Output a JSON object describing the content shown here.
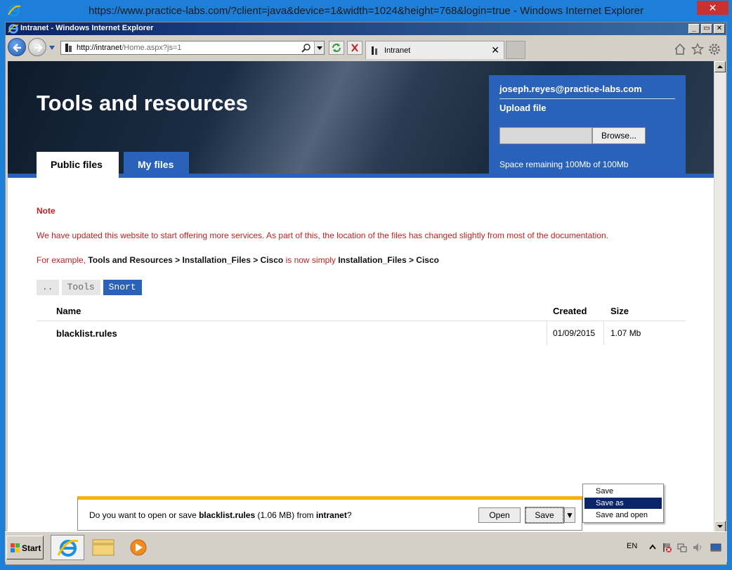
{
  "outer_window": {
    "title": "https://www.practice-labs.com/?client=java&device=1&width=1024&height=768&login=true - Windows  Internet Explorer",
    "close_label": "✕"
  },
  "ie_window": {
    "title": "Intranet - Windows Internet Explorer",
    "minimize_label": "_",
    "restore_label": "▭",
    "close_label": "✕"
  },
  "toolbar": {
    "url_host": "http://intranet",
    "url_path": "/Home.aspx?js=1",
    "tab_label": "Intranet",
    "tab_close_label": "✕"
  },
  "page": {
    "title": "Tools and resources",
    "tabs": [
      {
        "label": "Public files",
        "active": true
      },
      {
        "label": "My files",
        "active": false
      }
    ],
    "user_panel": {
      "email": "joseph.reyes@practice-labs.com",
      "upload_label": "Upload file",
      "browse_label": "Browse...",
      "space": "Space remaining 100Mb of 100Mb"
    },
    "note": {
      "heading": "Note",
      "paragraph": "We have updated this website to start offering more services. As part of this, the location of the files has changed slightly from most of the documentation.",
      "example_prefix": "For example, ",
      "example_old_path": "Tools and Resources > Installation_Files > Cisco",
      "example_mid": " is now simply ",
      "example_new_path": "Installation_Files > Cisco"
    },
    "breadcrumbs": [
      {
        "label": "..",
        "active": false
      },
      {
        "label": "Tools",
        "active": false
      },
      {
        "label": "Snort",
        "active": true
      }
    ],
    "table": {
      "headers": {
        "name": "Name",
        "created": "Created",
        "size": "Size"
      },
      "rows": [
        {
          "name": "blacklist.rules",
          "created": "01/09/2015",
          "size": "1.07 Mb"
        }
      ]
    }
  },
  "download_bar": {
    "msg_prefix": "Do you want to open or save ",
    "file": "blacklist.rules",
    "msg_size": " (1.06 MB) from ",
    "source": "intranet",
    "msg_suffix": "?",
    "open_label": "Open",
    "save_label": "Save",
    "arrow_label": "▼"
  },
  "save_menu": {
    "items": [
      {
        "label": "Save",
        "selected": false
      },
      {
        "label": "Save as",
        "selected": true
      },
      {
        "label": "Save and open",
        "selected": false
      }
    ]
  },
  "taskbar": {
    "start_label": "Start",
    "lang": "EN"
  },
  "colors": {
    "accent_blue": "#2a62b9",
    "note_red": "#c62020",
    "download_bar_accent": "#f5b301",
    "menu_selection": "#0a246a"
  }
}
